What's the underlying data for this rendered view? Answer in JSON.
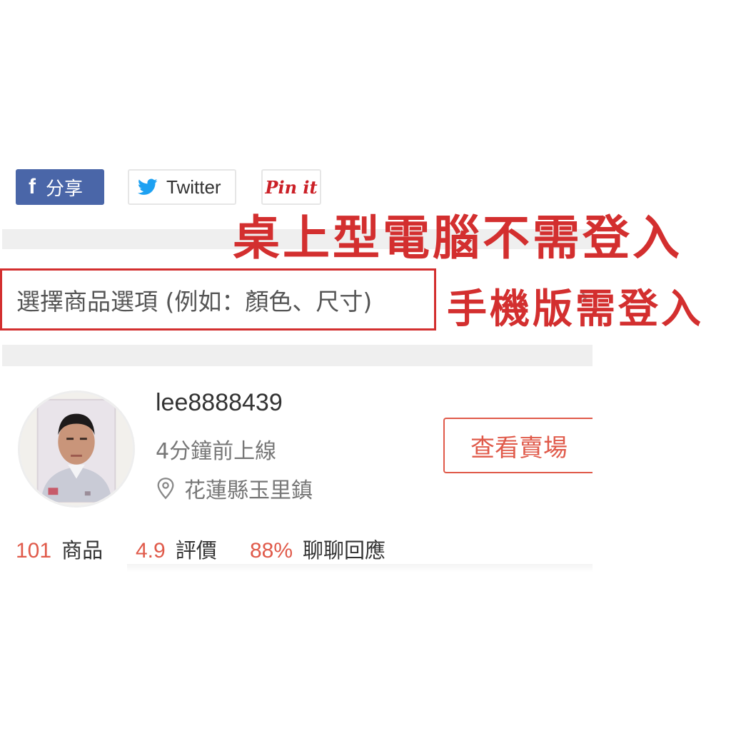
{
  "share": {
    "facebook_icon": "f",
    "facebook_label": "分享",
    "twitter_label": "Twitter",
    "pinterest_label": "Pin it"
  },
  "annotations": {
    "desktop_note": "桌上型電腦不需登入",
    "mobile_note": "手機版需登入"
  },
  "option_select": {
    "label": "選擇商品選項 (例如：顏色、尺寸)",
    "chevron": "›"
  },
  "seller": {
    "username": "lee8888439",
    "status": "4分鐘前上線",
    "location": "花蓮縣玉里鎮",
    "shop_button_label": "查看賣場"
  },
  "stats": [
    {
      "value": "101",
      "label": "商品"
    },
    {
      "value": "4.9",
      "label": "評價"
    },
    {
      "value": "88%",
      "label": "聊聊回應"
    }
  ],
  "colors": {
    "facebook": "#4a66a8",
    "twitter": "#1da1f2",
    "pinterest": "#cb2027",
    "annotation_red": "#d32f2f",
    "accent": "#e05a4a"
  },
  "icons": {
    "facebook": "facebook-icon",
    "twitter": "twitter-bird-icon",
    "pinterest": "pinterest-logo-icon",
    "location": "map-pin-icon",
    "chevron": "chevron-right-icon"
  }
}
